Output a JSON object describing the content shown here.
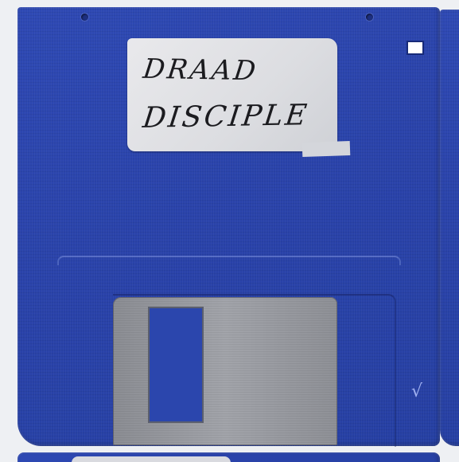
{
  "photo": {
    "subject": "floppy-disk",
    "disk_color": "#2b45ad",
    "label": {
      "lines": [
        "DRAAD",
        "DISCIPLE"
      ]
    },
    "icons": {
      "write_protect": "write-protect-notch-icon",
      "shutter": "metal-shutter",
      "holes": "mounting-hole-icon"
    }
  }
}
